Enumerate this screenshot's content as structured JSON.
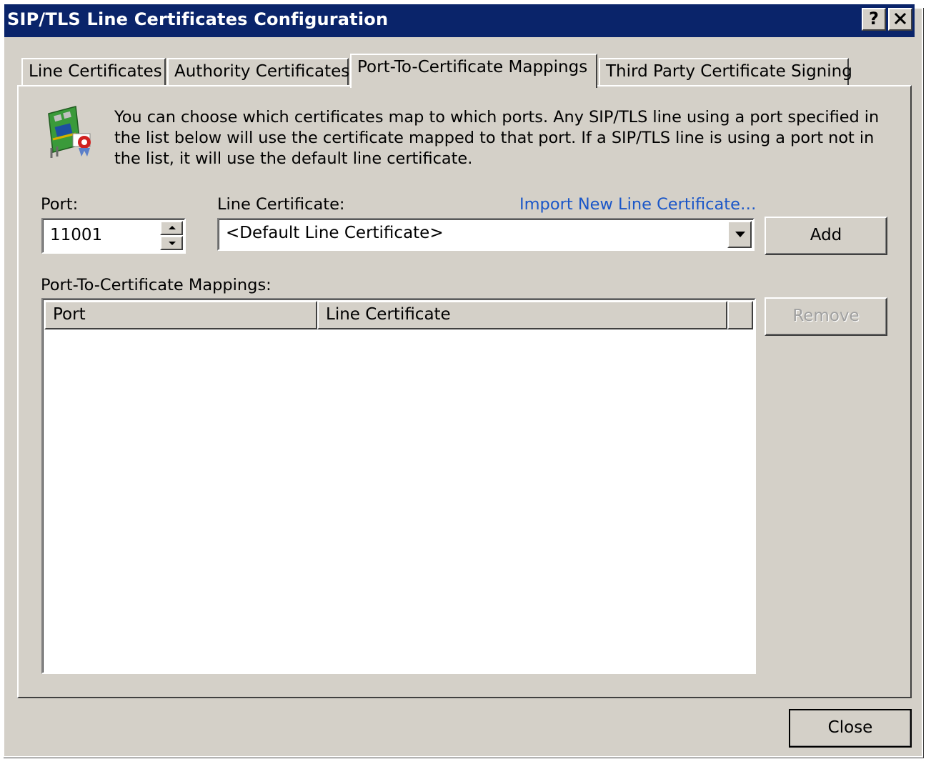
{
  "window": {
    "title": "SIP/TLS Line Certificates Configuration",
    "help_button": "?",
    "close_button": "✕"
  },
  "tabs": [
    {
      "label": "Line Certificates",
      "active": false
    },
    {
      "label": "Authority Certificates",
      "active": false
    },
    {
      "label": "Port-To-Certificate Mappings",
      "active": true
    },
    {
      "label": "Third Party Certificate Signing",
      "active": false
    }
  ],
  "panel": {
    "description": "You can choose which certificates map to which ports. Any SIP/TLS line using a port specified in the list below will use the certificate mapped to that port. If a SIP/TLS line is using a port not in the list, it will use the default line certificate.",
    "port_label": "Port:",
    "port_value": "11001",
    "line_certificate_label": "Line Certificate:",
    "import_link": "Import New Line Certificate…",
    "line_certificate_selected": "<Default Line Certificate>",
    "add_button": "Add",
    "mappings_label": "Port-To-Certificate Mappings:",
    "columns": [
      "Port",
      "Line Certificate"
    ],
    "rows": [],
    "remove_button": "Remove",
    "remove_enabled": false
  },
  "footer": {
    "close_button": "Close"
  },
  "colors": {
    "titlebar": "#0a246a",
    "dialog_face": "#d4d0c8",
    "link": "#1a56c8",
    "disabled_text": "#a0a0a0"
  },
  "icons": {
    "info": "certificate-card-icon"
  }
}
